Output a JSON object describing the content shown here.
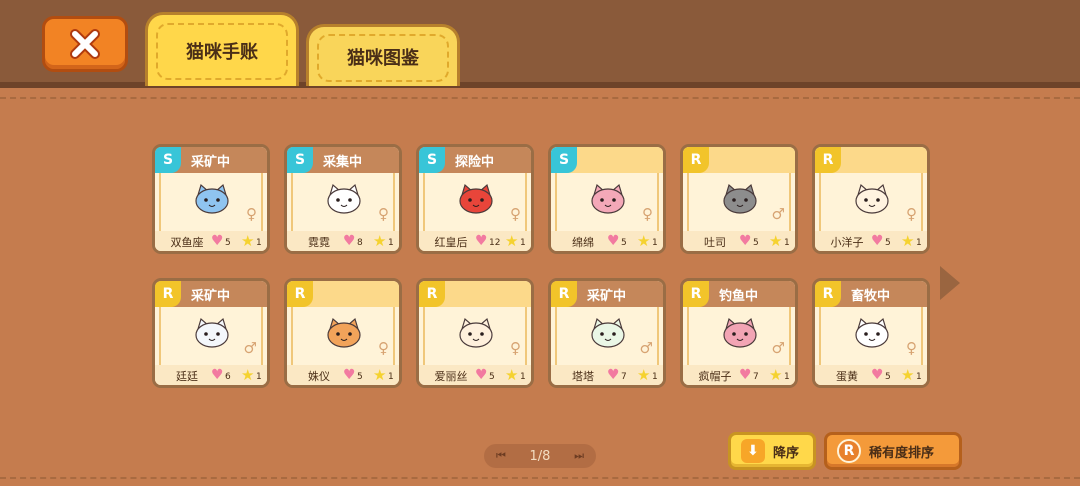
{
  "tabs": [
    {
      "label": "猫咪手账",
      "active": true
    },
    {
      "label": "猫咪图鉴",
      "active": false
    }
  ],
  "cards": [
    {
      "rarity": "S",
      "status": "采矿中",
      "name": "双鱼座",
      "hearts": "5",
      "stars": "1",
      "gender": "♀",
      "icon": "blue-fish-cat-icon",
      "color": "#8fc4f0"
    },
    {
      "rarity": "S",
      "status": "采集中",
      "name": "霓霓",
      "hearts": "8",
      "stars": "1",
      "gender": "♀",
      "icon": "unicorn-cat-icon",
      "color": "#ffffff"
    },
    {
      "rarity": "S",
      "status": "探险中",
      "name": "红皇后",
      "hearts": "12",
      "stars": "1",
      "gender": "♀",
      "icon": "red-queen-cat-icon",
      "color": "#e8453a"
    },
    {
      "rarity": "S",
      "status": "",
      "name": "绵绵",
      "hearts": "5",
      "stars": "1",
      "gender": "♀",
      "icon": "pink-flower-cat-icon",
      "color": "#f4a8b8"
    },
    {
      "rarity": "R",
      "status": "",
      "name": "吐司",
      "hearts": "5",
      "stars": "1",
      "gender": "♂",
      "icon": "gray-cat-icon",
      "color": "#8d8d8d"
    },
    {
      "rarity": "R",
      "status": "",
      "name": "小洋子",
      "hearts": "5",
      "stars": "1",
      "gender": "♀",
      "icon": "cream-cat-icon",
      "color": "#fff3e0"
    },
    {
      "rarity": "R",
      "status": "采矿中",
      "name": "廷廷",
      "hearts": "6",
      "stars": "1",
      "gender": "♂",
      "icon": "white-cat-icon",
      "color": "#f4f7fb"
    },
    {
      "rarity": "R",
      "status": "",
      "name": "姝仪",
      "hearts": "5",
      "stars": "1",
      "gender": "♀",
      "icon": "nurse-cat-icon",
      "color": "#f2a35a"
    },
    {
      "rarity": "R",
      "status": "",
      "name": "爱丽丝",
      "hearts": "5",
      "stars": "1",
      "gender": "♀",
      "icon": "alice-cat-icon",
      "color": "#fff0dc"
    },
    {
      "rarity": "R",
      "status": "采矿中",
      "name": "塔塔",
      "hearts": "7",
      "stars": "1",
      "gender": "♂",
      "icon": "top-hat-cat-icon",
      "color": "#eaf7e6"
    },
    {
      "rarity": "R",
      "status": "钓鱼中",
      "name": "疯帽子",
      "hearts": "7",
      "stars": "1",
      "gender": "♂",
      "icon": "mad-hatter-cat-icon",
      "color": "#f2a4b4"
    },
    {
      "rarity": "R",
      "status": "畜牧中",
      "name": "蛋黄",
      "hearts": "5",
      "stars": "1",
      "gender": "♀",
      "icon": "egg-yolk-cat-icon",
      "color": "#ffffff"
    }
  ],
  "pager": {
    "text": "1/8"
  },
  "buttons": {
    "sort_desc": "降序",
    "sort_rarity": "稀有度排序",
    "sort_rarity_icon": "R"
  }
}
